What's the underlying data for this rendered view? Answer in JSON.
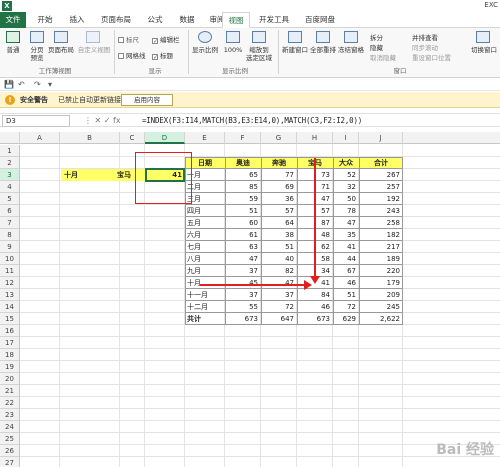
{
  "app": {
    "logo": "X",
    "title": "EXC"
  },
  "tabs": [
    {
      "label": "文件",
      "file": true
    },
    {
      "label": "开始"
    },
    {
      "label": "插入"
    },
    {
      "label": "页面布局"
    },
    {
      "label": "公式"
    },
    {
      "label": "数据"
    },
    {
      "label": "审阅"
    },
    {
      "label": "视图",
      "active": true
    },
    {
      "label": "开发工具"
    },
    {
      "label": "百度网盘"
    }
  ],
  "ribbon": {
    "normal": "普通",
    "page_break_preview": "分页\n预览",
    "page_layout": "页面布局",
    "custom_views": "自定义视图",
    "group_workbook_views": "工作簿视图",
    "ruler": "标尺",
    "formula_bar": "编辑栏",
    "gridlines": "网格线",
    "headings": "标题",
    "group_show": "显示",
    "zoom": "显示比例",
    "zoom_100": "100%",
    "zoom_selection": "缩放到\n选定区域",
    "group_zoom": "显示比例",
    "new_window": "新建窗口",
    "arrange_all": "全部重排",
    "freeze_panes": "冻结窗格",
    "split": "拆分",
    "hide": "隐藏",
    "unhide": "取消隐藏",
    "view_side_by_side": "并排查看",
    "sync_scroll": "同步滚动",
    "reset_position": "重设窗口位置",
    "group_window": "窗口",
    "switch_windows": "切换窗口"
  },
  "qat": {
    "save": "💾",
    "undo": "↶",
    "redo": "↷",
    "more": "▾"
  },
  "security": {
    "icon": "!",
    "title": "安全警告",
    "message": "已禁止自动更新链接",
    "button": "启用内容"
  },
  "formula_bar": {
    "name_box": "D3",
    "controls": "⋮   ✕   ✓   fx",
    "formula": "=INDEX(F3:I14,MATCH(B3,E3:E14,0),MATCH(C3,F2:I2,0))"
  },
  "grid": {
    "columns": [
      "A",
      "B",
      "C",
      "D",
      "E",
      "F",
      "G",
      "H",
      "I",
      "J"
    ],
    "rows": [
      "1",
      "2",
      "3",
      "4",
      "5",
      "6",
      "7",
      "8",
      "9",
      "10",
      "11",
      "12",
      "13",
      "14",
      "15",
      "16",
      "17",
      "18",
      "19",
      "20",
      "21",
      "22",
      "23",
      "24",
      "25",
      "26",
      "27"
    ],
    "selected_col": "D",
    "selected_row": "3"
  },
  "lookup": {
    "b3": "十月",
    "c3": "宝马",
    "d3": "41"
  },
  "table": {
    "headers": [
      "日期",
      "奥迪",
      "奔驰",
      "宝马",
      "大众",
      "合计"
    ],
    "rows": [
      [
        "一月",
        "65",
        "77",
        "73",
        "52",
        "267"
      ],
      [
        "二月",
        "85",
        "69",
        "71",
        "32",
        "257"
      ],
      [
        "三月",
        "59",
        "36",
        "47",
        "50",
        "192"
      ],
      [
        "四月",
        "51",
        "57",
        "57",
        "78",
        "243"
      ],
      [
        "五月",
        "60",
        "64",
        "87",
        "47",
        "258"
      ],
      [
        "六月",
        "61",
        "38",
        "48",
        "35",
        "182"
      ],
      [
        "七月",
        "63",
        "51",
        "62",
        "41",
        "217"
      ],
      [
        "八月",
        "47",
        "40",
        "58",
        "44",
        "189"
      ],
      [
        "九月",
        "37",
        "82",
        "34",
        "67",
        "220"
      ],
      [
        "十月",
        "45",
        "47",
        "41",
        "46",
        "179"
      ],
      [
        "十一月",
        "37",
        "37",
        "84",
        "51",
        "209"
      ],
      [
        "十二月",
        "55",
        "72",
        "46",
        "72",
        "245"
      ],
      [
        "共计",
        "673",
        "647",
        "673",
        "629",
        "2,622"
      ]
    ]
  },
  "watermark": "Bai 经验",
  "colors": {
    "excel_green": "#217346",
    "highlight_yellow": "#ffff66",
    "annotation_red": "#e02020"
  }
}
